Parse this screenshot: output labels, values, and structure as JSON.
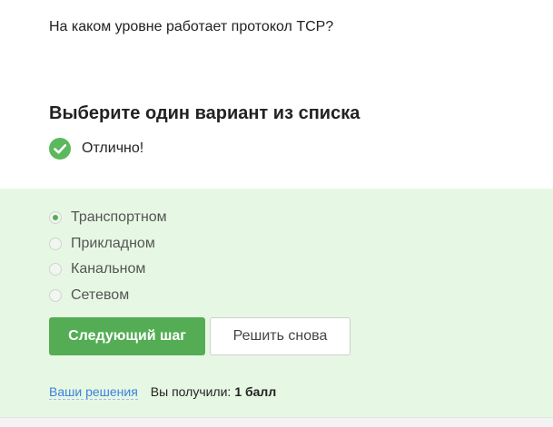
{
  "question": {
    "text": "На каком уровне работает протокол TCP?"
  },
  "instruction": {
    "title": "Выберите один вариант из списка"
  },
  "status": {
    "icon": "check-circle-icon",
    "text": "Отлично!",
    "color": "#5cb85c"
  },
  "options": [
    {
      "label": "Транспортном",
      "selected": true
    },
    {
      "label": "Прикладном",
      "selected": false
    },
    {
      "label": "Канальном",
      "selected": false
    },
    {
      "label": "Сетевом",
      "selected": false
    }
  ],
  "buttons": {
    "next_label": "Следующий шаг",
    "retry_label": "Решить снова"
  },
  "footer": {
    "solutions_link": "Ваши решения",
    "score_label": "Вы получили:",
    "score_value": "1 балл"
  },
  "colors": {
    "accent": "#54ad54",
    "panel_background": "#e6f8e3",
    "link": "#3c7ee0"
  }
}
